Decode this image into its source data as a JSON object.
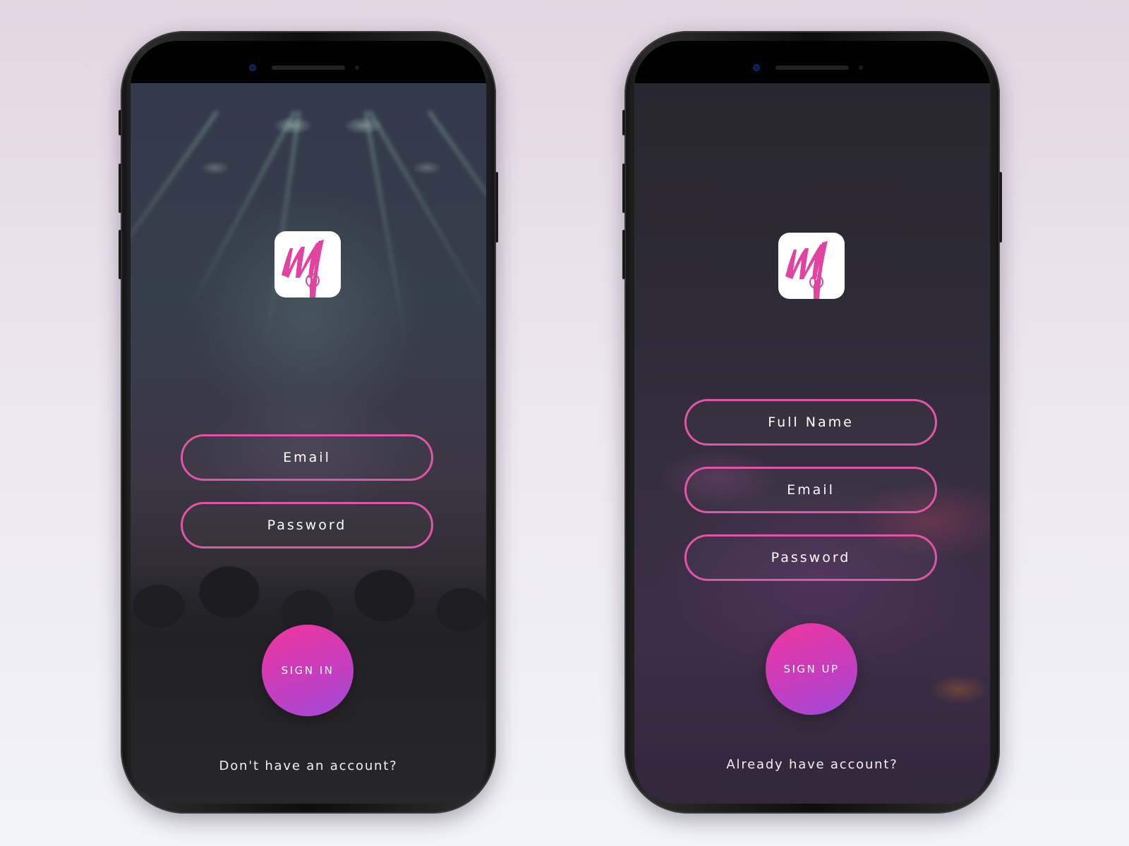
{
  "colors": {
    "accent": "#e055a6",
    "button_gradient_start": "#f0359f",
    "button_gradient_end": "#a14ad9",
    "background_top": "#e3d6e3",
    "background_bottom": "#f2f4f9"
  },
  "login_screen": {
    "logo_icon": "app-logo-m-play",
    "email_placeholder": "Email",
    "password_placeholder": "Password",
    "sign_in_label": "SIGN IN",
    "footer_link": "Don't have an account?"
  },
  "signup_screen": {
    "logo_icon": "app-logo-m-play",
    "full_name_placeholder": "Full Name",
    "email_placeholder": "Email",
    "password_placeholder": "Password",
    "sign_up_label": "SIGN UP",
    "footer_link": "Already have account?"
  }
}
